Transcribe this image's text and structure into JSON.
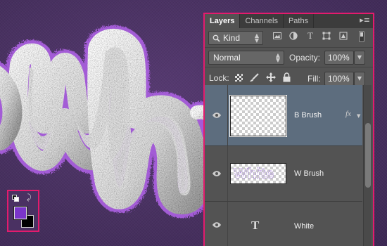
{
  "panel": {
    "tabs": [
      {
        "label": "Layers",
        "active": true
      },
      {
        "label": "Channels",
        "active": false
      },
      {
        "label": "Paths",
        "active": false
      }
    ],
    "menu_icon": "panel-menu-icon",
    "filter": {
      "icon": "search-icon",
      "value": "Kind"
    },
    "filter_icons": [
      "pixel-layer-filter-icon",
      "adjustment-layer-filter-icon",
      "type-layer-filter-icon",
      "shape-layer-filter-icon",
      "smart-object-filter-icon"
    ],
    "blend_mode": "Normal",
    "opacity_label": "Opacity:",
    "opacity_value": "100%",
    "lock_label": "Lock:",
    "lock_icons": [
      "lock-transparent-pixels-icon",
      "lock-image-pixels-icon",
      "lock-position-icon",
      "lock-all-icon"
    ],
    "fill_label": "Fill:",
    "fill_value": "100%",
    "layers": [
      {
        "name": "B Brush",
        "type": "pixel",
        "selected": true,
        "visible": true,
        "fx": "fx"
      },
      {
        "name": "W Brush",
        "type": "pixel",
        "selected": false,
        "visible": true,
        "fx": ""
      },
      {
        "name": "White",
        "type": "text",
        "selected": false,
        "visible": true,
        "fx": ""
      }
    ]
  },
  "swatches": {
    "foreground": "#7a35c9",
    "background": "#000000",
    "highlight": "#e31b6d"
  },
  "canvas": {
    "background_color": "#4a3162",
    "text_fill": "#e8e8e8",
    "glitter_color": "#a35bd6"
  }
}
